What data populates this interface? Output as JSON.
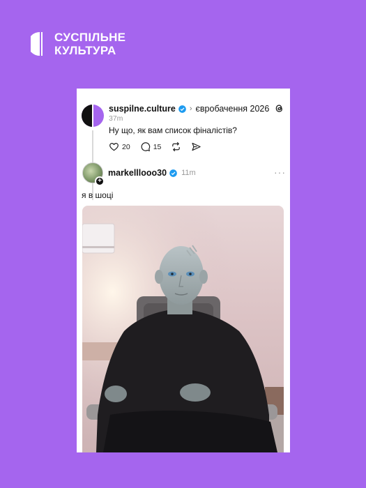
{
  "brand": {
    "line1": "СУСПІЛЬНЕ",
    "line2": "КУЛЬТУРА"
  },
  "parent_post": {
    "username": "suspilne.culture",
    "topic": "євробачення 2026",
    "time": "37m",
    "text": "Ну що, як вам список фіналістів?",
    "likes": "20",
    "comments": "15"
  },
  "reply_post": {
    "username": "markelllooo30",
    "time": "11m",
    "text": "я в шоці",
    "more": "···"
  },
  "colors": {
    "background": "#a565ee",
    "verified": "#1d9bf0"
  }
}
